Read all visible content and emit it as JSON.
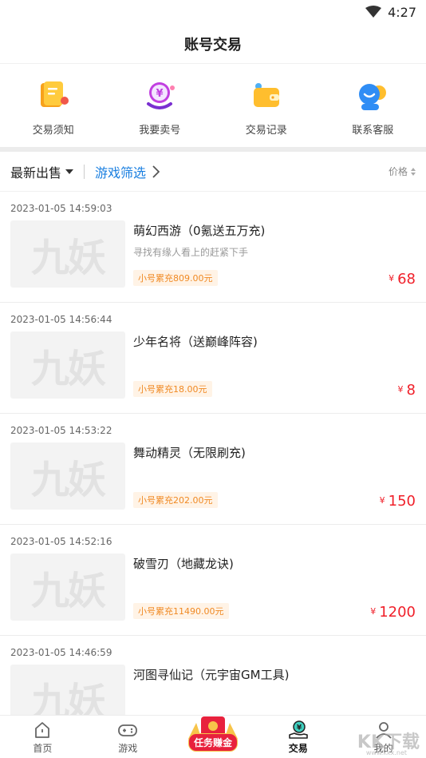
{
  "status_bar": {
    "time": "4:27"
  },
  "header": {
    "title": "账号交易"
  },
  "quick_menu": [
    {
      "label": "交易须知",
      "icon": "notice-icon"
    },
    {
      "label": "我要卖号",
      "icon": "sell-account-icon"
    },
    {
      "label": "交易记录",
      "icon": "wallet-record-icon"
    },
    {
      "label": "联系客服",
      "icon": "customer-service-icon"
    }
  ],
  "filter": {
    "latest_label": "最新出售",
    "game_filter_label": "游戏筛选",
    "price_label": "价格"
  },
  "listings": [
    {
      "time": "2023-01-05 14:59:03",
      "thumb_text": "九妖",
      "title": "萌幻西游（0氪送五万充)",
      "desc": "寻找有缘人看上的赶紧下手",
      "recharge": "小号累充809.00元",
      "currency": "¥",
      "price": "68"
    },
    {
      "time": "2023-01-05 14:56:44",
      "thumb_text": "九妖",
      "title": "少年名将（送巅峰阵容)",
      "desc": "",
      "recharge": "小号累充18.00元",
      "currency": "¥",
      "price": "8"
    },
    {
      "time": "2023-01-05 14:53:22",
      "thumb_text": "九妖",
      "title": "舞动精灵（无限刷充)",
      "desc": "",
      "recharge": "小号累充202.00元",
      "currency": "¥",
      "price": "150"
    },
    {
      "time": "2023-01-05 14:52:16",
      "thumb_text": "九妖",
      "title": "破雪刃（地藏龙诀)",
      "desc": "",
      "recharge": "小号累充11490.00元",
      "currency": "¥",
      "price": "1200"
    },
    {
      "time": "2023-01-05 14:46:59",
      "thumb_text": "九妖",
      "title": "河图寻仙记（元宇宙GM工具)",
      "desc": "",
      "recharge": "",
      "currency": "",
      "price": ""
    }
  ],
  "tab_bar": {
    "home": "首页",
    "games": "游戏",
    "promo": "任务赚金",
    "trade": "交易",
    "mine": "我的"
  },
  "watermark": {
    "text": "KK下载",
    "sub": "www.kkx.net"
  },
  "colors": {
    "accent_blue": "#1a7fe0",
    "price_red": "#f0202a",
    "tag_orange": "#f08a24"
  }
}
